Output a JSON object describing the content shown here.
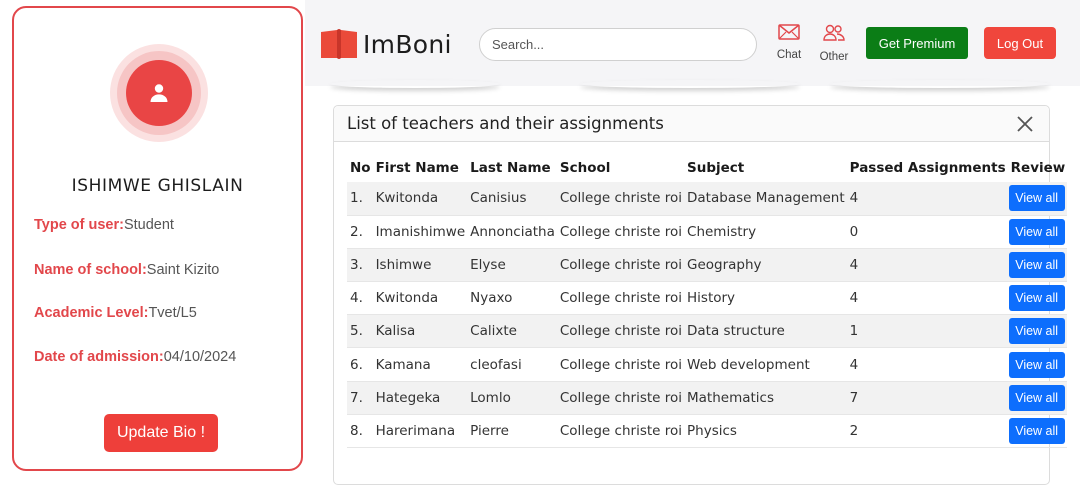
{
  "profile": {
    "name": "ISHIMWE GHISLAIN",
    "fields": [
      {
        "label": "Type of user:",
        "value": "Student"
      },
      {
        "label": "Name of school:",
        "value": "Saint Kizito"
      },
      {
        "label": "Academic Level:",
        "value": "Tvet/L5"
      },
      {
        "label": "Date of admission:",
        "value": "04/10/2024"
      }
    ],
    "update_label": "Update Bio !"
  },
  "header": {
    "brand": "ImBoni",
    "search_placeholder": "Search...",
    "chat_label": "Chat",
    "other_label": "Other",
    "premium_label": "Get Premium",
    "logout_label": "Log Out"
  },
  "panel": {
    "title": "List of teachers and their assignments",
    "columns": [
      "No",
      "First Name",
      "Last Name",
      "School",
      "Subject",
      "Passed Assignments",
      "Review"
    ],
    "rows": [
      {
        "no": "1.",
        "first": "Kwitonda",
        "last": "Canisius",
        "school": "College christe roi",
        "subject": "Database Management",
        "passed": "4",
        "review": "View all"
      },
      {
        "no": "2.",
        "first": "Imanishimwe",
        "last": "Annonciatha",
        "school": "College christe roi",
        "subject": "Chemistry",
        "passed": "0",
        "review": "View all"
      },
      {
        "no": "3.",
        "first": "Ishimwe",
        "last": "Elyse",
        "school": "College christe roi",
        "subject": "Geography",
        "passed": "4",
        "review": "View all"
      },
      {
        "no": "4.",
        "first": "Kwitonda",
        "last": "Nyaxo",
        "school": "College christe roi",
        "subject": "History",
        "passed": "4",
        "review": "View all"
      },
      {
        "no": "5.",
        "first": "Kalisa",
        "last": "Calixte",
        "school": "College christe roi",
        "subject": "Data structure",
        "passed": "1",
        "review": "View all"
      },
      {
        "no": "6.",
        "first": "Kamana",
        "last": "cleofasi",
        "school": "College christe roi",
        "subject": "Web development",
        "passed": "4",
        "review": "View all"
      },
      {
        "no": "7.",
        "first": "Hategeka",
        "last": "Lomlo",
        "school": "College christe roi",
        "subject": "Mathematics",
        "passed": "7",
        "review": "View all"
      },
      {
        "no": "8.",
        "first": "Harerimana",
        "last": "Pierre",
        "school": "College christe roi",
        "subject": "Physics",
        "passed": "2",
        "review": "View all"
      }
    ]
  },
  "colors": {
    "accent_red": "#e2474b",
    "premium_green": "#0b7d16",
    "view_blue": "#0d6efd"
  },
  "icons": {
    "avatar": "user-icon",
    "brand": "book-icon",
    "chat": "envelope-icon",
    "other": "users-icon",
    "close": "close-icon"
  }
}
